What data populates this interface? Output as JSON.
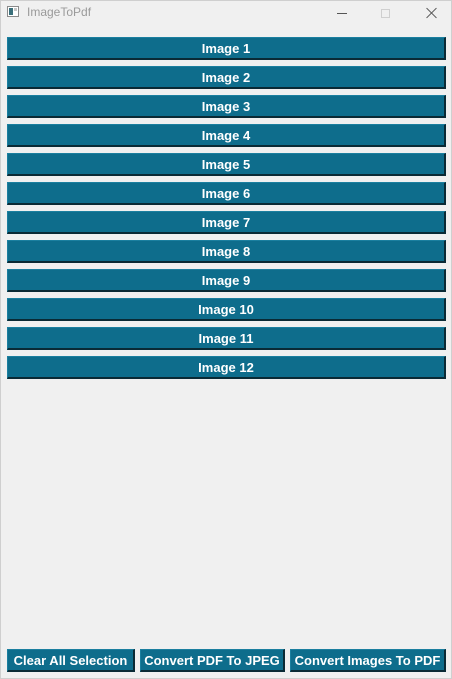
{
  "window": {
    "title": "ImageToPdf",
    "app_icon": "image-app-icon",
    "controls": {
      "minimize_icon": "minimize-icon",
      "maximize_icon": "maximize-icon",
      "close_icon": "close-icon"
    }
  },
  "image_list": {
    "items": [
      {
        "label": "Image 1"
      },
      {
        "label": "Image 2"
      },
      {
        "label": "Image 3"
      },
      {
        "label": "Image 4"
      },
      {
        "label": "Image 5"
      },
      {
        "label": "Image 6"
      },
      {
        "label": "Image 7"
      },
      {
        "label": "Image 8"
      },
      {
        "label": "Image 9"
      },
      {
        "label": "Image 10"
      },
      {
        "label": "Image 11"
      },
      {
        "label": "Image 12"
      }
    ]
  },
  "actions": {
    "clear_label": "Clear All Selection",
    "pdf_to_jpeg_label": "Convert PDF To JPEG",
    "images_to_pdf_label": "Convert Images To PDF"
  },
  "colors": {
    "button_bg": "#0e6d8c",
    "button_text": "#ffffff",
    "window_bg": "#f0f0f0",
    "title_text": "#9a9a9a"
  }
}
